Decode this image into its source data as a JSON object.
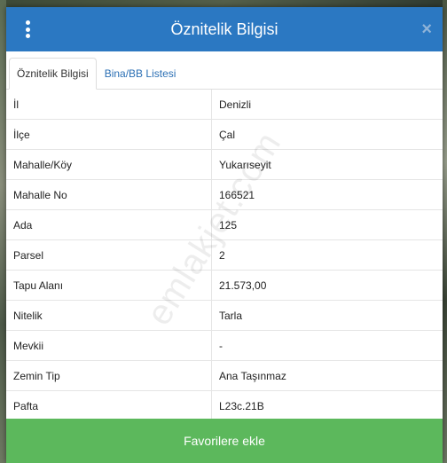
{
  "dialog": {
    "title": "Öznitelik Bilgisi",
    "close_symbol": "×",
    "menu_icon": "vertical-dots-icon"
  },
  "tabs": [
    {
      "label": "Öznitelik Bilgisi",
      "active": true
    },
    {
      "label": "Bina/BB Listesi",
      "active": false
    }
  ],
  "rows": [
    {
      "label": "İl",
      "value": "Denizli"
    },
    {
      "label": "İlçe",
      "value": "Çal"
    },
    {
      "label": "Mahalle/Köy",
      "value": "Yukarıseyit"
    },
    {
      "label": "Mahalle No",
      "value": "166521"
    },
    {
      "label": "Ada",
      "value": "125"
    },
    {
      "label": "Parsel",
      "value": "2"
    },
    {
      "label": "Tapu Alanı",
      "value": "21.573,00"
    },
    {
      "label": "Nitelik",
      "value": "Tarla"
    },
    {
      "label": "Mevkii",
      "value": "-"
    },
    {
      "label": "Zemin Tip",
      "value": "Ana Taşınmaz"
    },
    {
      "label": "Pafta",
      "value": "L23c.21B"
    }
  ],
  "watermark": "emlakjet.com",
  "footer": {
    "favorite_label": "Favorilere ekle"
  },
  "colors": {
    "header": "#2b78c2",
    "footer": "#5cb85c",
    "tab_link": "#2b6fb4"
  }
}
